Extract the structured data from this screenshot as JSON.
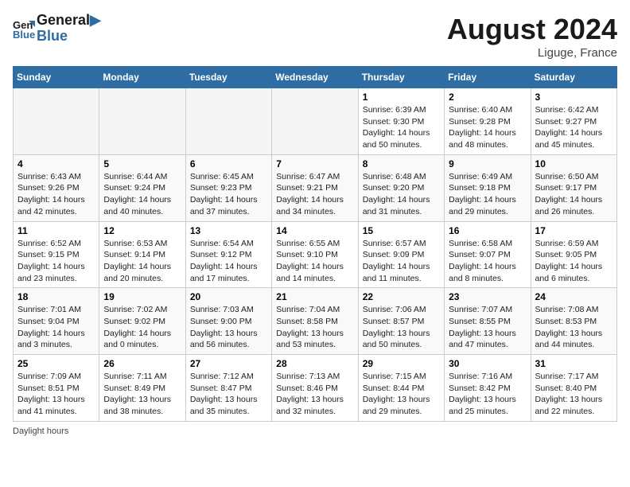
{
  "header": {
    "logo_line1": "General",
    "logo_line2": "Blue",
    "month_year": "August 2024",
    "location": "Liguge, France"
  },
  "weekdays": [
    "Sunday",
    "Monday",
    "Tuesday",
    "Wednesday",
    "Thursday",
    "Friday",
    "Saturday"
  ],
  "weeks": [
    [
      {
        "day": "",
        "info": ""
      },
      {
        "day": "",
        "info": ""
      },
      {
        "day": "",
        "info": ""
      },
      {
        "day": "",
        "info": ""
      },
      {
        "day": "1",
        "info": "Sunrise: 6:39 AM\nSunset: 9:30 PM\nDaylight: 14 hours\nand 50 minutes."
      },
      {
        "day": "2",
        "info": "Sunrise: 6:40 AM\nSunset: 9:28 PM\nDaylight: 14 hours\nand 48 minutes."
      },
      {
        "day": "3",
        "info": "Sunrise: 6:42 AM\nSunset: 9:27 PM\nDaylight: 14 hours\nand 45 minutes."
      }
    ],
    [
      {
        "day": "4",
        "info": "Sunrise: 6:43 AM\nSunset: 9:26 PM\nDaylight: 14 hours\nand 42 minutes."
      },
      {
        "day": "5",
        "info": "Sunrise: 6:44 AM\nSunset: 9:24 PM\nDaylight: 14 hours\nand 40 minutes."
      },
      {
        "day": "6",
        "info": "Sunrise: 6:45 AM\nSunset: 9:23 PM\nDaylight: 14 hours\nand 37 minutes."
      },
      {
        "day": "7",
        "info": "Sunrise: 6:47 AM\nSunset: 9:21 PM\nDaylight: 14 hours\nand 34 minutes."
      },
      {
        "day": "8",
        "info": "Sunrise: 6:48 AM\nSunset: 9:20 PM\nDaylight: 14 hours\nand 31 minutes."
      },
      {
        "day": "9",
        "info": "Sunrise: 6:49 AM\nSunset: 9:18 PM\nDaylight: 14 hours\nand 29 minutes."
      },
      {
        "day": "10",
        "info": "Sunrise: 6:50 AM\nSunset: 9:17 PM\nDaylight: 14 hours\nand 26 minutes."
      }
    ],
    [
      {
        "day": "11",
        "info": "Sunrise: 6:52 AM\nSunset: 9:15 PM\nDaylight: 14 hours\nand 23 minutes."
      },
      {
        "day": "12",
        "info": "Sunrise: 6:53 AM\nSunset: 9:14 PM\nDaylight: 14 hours\nand 20 minutes."
      },
      {
        "day": "13",
        "info": "Sunrise: 6:54 AM\nSunset: 9:12 PM\nDaylight: 14 hours\nand 17 minutes."
      },
      {
        "day": "14",
        "info": "Sunrise: 6:55 AM\nSunset: 9:10 PM\nDaylight: 14 hours\nand 14 minutes."
      },
      {
        "day": "15",
        "info": "Sunrise: 6:57 AM\nSunset: 9:09 PM\nDaylight: 14 hours\nand 11 minutes."
      },
      {
        "day": "16",
        "info": "Sunrise: 6:58 AM\nSunset: 9:07 PM\nDaylight: 14 hours\nand 8 minutes."
      },
      {
        "day": "17",
        "info": "Sunrise: 6:59 AM\nSunset: 9:05 PM\nDaylight: 14 hours\nand 6 minutes."
      }
    ],
    [
      {
        "day": "18",
        "info": "Sunrise: 7:01 AM\nSunset: 9:04 PM\nDaylight: 14 hours\nand 3 minutes."
      },
      {
        "day": "19",
        "info": "Sunrise: 7:02 AM\nSunset: 9:02 PM\nDaylight: 14 hours\nand 0 minutes."
      },
      {
        "day": "20",
        "info": "Sunrise: 7:03 AM\nSunset: 9:00 PM\nDaylight: 13 hours\nand 56 minutes."
      },
      {
        "day": "21",
        "info": "Sunrise: 7:04 AM\nSunset: 8:58 PM\nDaylight: 13 hours\nand 53 minutes."
      },
      {
        "day": "22",
        "info": "Sunrise: 7:06 AM\nSunset: 8:57 PM\nDaylight: 13 hours\nand 50 minutes."
      },
      {
        "day": "23",
        "info": "Sunrise: 7:07 AM\nSunset: 8:55 PM\nDaylight: 13 hours\nand 47 minutes."
      },
      {
        "day": "24",
        "info": "Sunrise: 7:08 AM\nSunset: 8:53 PM\nDaylight: 13 hours\nand 44 minutes."
      }
    ],
    [
      {
        "day": "25",
        "info": "Sunrise: 7:09 AM\nSunset: 8:51 PM\nDaylight: 13 hours\nand 41 minutes."
      },
      {
        "day": "26",
        "info": "Sunrise: 7:11 AM\nSunset: 8:49 PM\nDaylight: 13 hours\nand 38 minutes."
      },
      {
        "day": "27",
        "info": "Sunrise: 7:12 AM\nSunset: 8:47 PM\nDaylight: 13 hours\nand 35 minutes."
      },
      {
        "day": "28",
        "info": "Sunrise: 7:13 AM\nSunset: 8:46 PM\nDaylight: 13 hours\nand 32 minutes."
      },
      {
        "day": "29",
        "info": "Sunrise: 7:15 AM\nSunset: 8:44 PM\nDaylight: 13 hours\nand 29 minutes."
      },
      {
        "day": "30",
        "info": "Sunrise: 7:16 AM\nSunset: 8:42 PM\nDaylight: 13 hours\nand 25 minutes."
      },
      {
        "day": "31",
        "info": "Sunrise: 7:17 AM\nSunset: 8:40 PM\nDaylight: 13 hours\nand 22 minutes."
      }
    ]
  ],
  "footer": "Daylight hours"
}
